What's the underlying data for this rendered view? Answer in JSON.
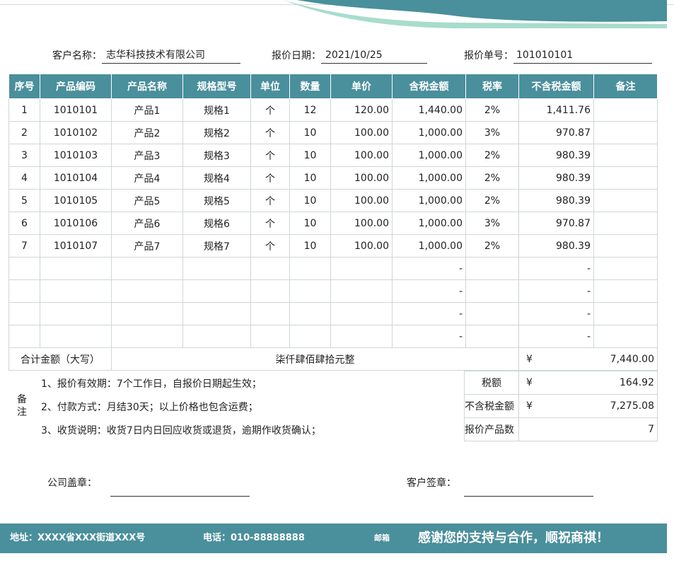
{
  "header": {
    "customer_label": "客户名称：",
    "customer_value": "志华科技技术有限公司",
    "date_label": "报价日期：",
    "date_value": "2021/10/25",
    "number_label": "报价单号：",
    "number_value": "101010101"
  },
  "table": {
    "columns": [
      "序号",
      "产品编码",
      "产品名称",
      "规格型号",
      "单位",
      "数量",
      "单价",
      "含税金额",
      "税率",
      "不含税金额",
      "备注"
    ],
    "rows": [
      {
        "no": "1",
        "code": "1010101",
        "name": "产品1",
        "spec": "规格1",
        "unit": "个",
        "qty": "12",
        "price": "120.00",
        "amount": "1,440.00",
        "rate": "2%",
        "net": "1,411.76",
        "note": ""
      },
      {
        "no": "2",
        "code": "1010102",
        "name": "产品2",
        "spec": "规格2",
        "unit": "个",
        "qty": "10",
        "price": "100.00",
        "amount": "1,000.00",
        "rate": "3%",
        "net": "970.87",
        "note": ""
      },
      {
        "no": "3",
        "code": "1010103",
        "name": "产品3",
        "spec": "规格3",
        "unit": "个",
        "qty": "10",
        "price": "100.00",
        "amount": "1,000.00",
        "rate": "2%",
        "net": "980.39",
        "note": ""
      },
      {
        "no": "4",
        "code": "1010104",
        "name": "产品4",
        "spec": "规格4",
        "unit": "个",
        "qty": "10",
        "price": "100.00",
        "amount": "1,000.00",
        "rate": "2%",
        "net": "980.39",
        "note": ""
      },
      {
        "no": "5",
        "code": "1010105",
        "name": "产品5",
        "spec": "规格5",
        "unit": "个",
        "qty": "10",
        "price": "100.00",
        "amount": "1,000.00",
        "rate": "2%",
        "net": "980.39",
        "note": ""
      },
      {
        "no": "6",
        "code": "1010106",
        "name": "产品6",
        "spec": "规格6",
        "unit": "个",
        "qty": "10",
        "price": "100.00",
        "amount": "1,000.00",
        "rate": "3%",
        "net": "970.87",
        "note": ""
      },
      {
        "no": "7",
        "code": "1010107",
        "name": "产品7",
        "spec": "规格7",
        "unit": "个",
        "qty": "10",
        "price": "100.00",
        "amount": "1,000.00",
        "rate": "2%",
        "net": "980.39",
        "note": ""
      },
      {
        "no": "",
        "code": "",
        "name": "",
        "spec": "",
        "unit": "",
        "qty": "",
        "price": "",
        "amount": "-",
        "rate": "",
        "net": "-",
        "note": ""
      },
      {
        "no": "",
        "code": "",
        "name": "",
        "spec": "",
        "unit": "",
        "qty": "",
        "price": "",
        "amount": "-",
        "rate": "",
        "net": "-",
        "note": ""
      },
      {
        "no": "",
        "code": "",
        "name": "",
        "spec": "",
        "unit": "",
        "qty": "",
        "price": "",
        "amount": "-",
        "rate": "",
        "net": "-",
        "note": ""
      },
      {
        "no": "",
        "code": "",
        "name": "",
        "spec": "",
        "unit": "",
        "qty": "",
        "price": "",
        "amount": "-",
        "rate": "",
        "net": "-",
        "note": ""
      }
    ],
    "total_label": "合计金额（大写）",
    "total_words": "柒仟肆佰肆拾元整",
    "total_currency": "¥",
    "total_value": "7,440.00"
  },
  "notes": {
    "side_label_1": "备",
    "side_label_2": "注",
    "lines": [
      "1、报价有效期：7个工作日，自报价日期起生效；",
      "2、付款方式：月结30天；以上价格也包含运费；",
      "3、收货说明：收货7日内日回应收货或退货，逾期作收货确认；"
    ]
  },
  "summary": {
    "tax_label": "税额",
    "tax_currency": "¥",
    "tax_value": "164.92",
    "net_label": "不含税金额",
    "net_currency": "¥",
    "net_value": "7,275.08",
    "count_label": "报价产品数",
    "count_value": "7"
  },
  "signatures": {
    "company_label": "公司盖章：",
    "customer_label": "客户签章："
  },
  "footer": {
    "address": "地址：XXXX省XXX街道XXX号",
    "phone": "电话：010-88888888",
    "email": "邮箱",
    "thanks": "感谢您的支持与合作，顺祝商祺！"
  },
  "colors": {
    "accent": "#4a8f9c",
    "wave_light": "#a8dccc"
  }
}
